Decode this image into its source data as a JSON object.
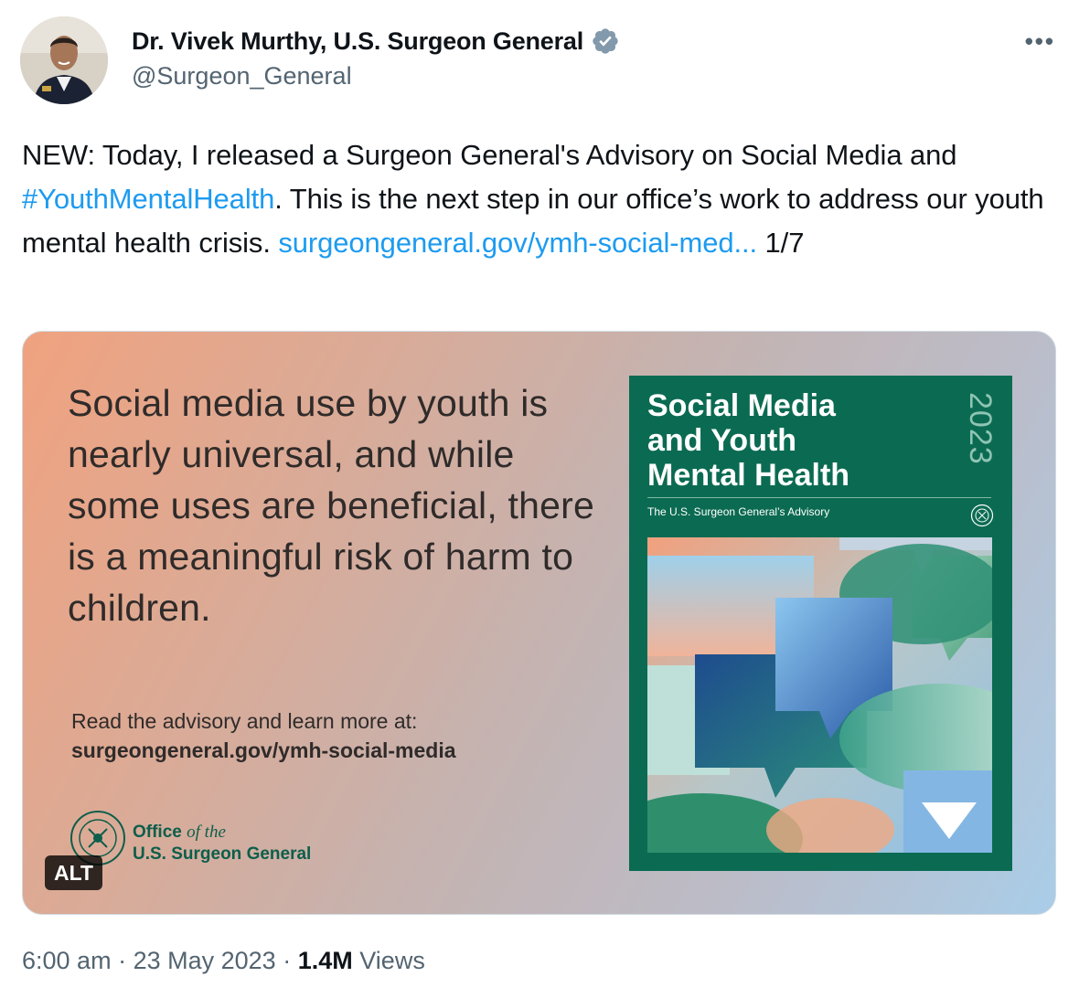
{
  "author": {
    "name": "Dr. Vivek Murthy, U.S. Surgeon General",
    "handle": "@Surgeon_General",
    "verified_icon": "verified-badge-icon"
  },
  "tweet": {
    "text_1": "NEW: Today, I released a Surgeon General's Advisory on Social Media and ",
    "hashtag": "#YouthMentalHealth",
    "text_2": ". This is the next step in our office’s work to address our youth mental health crisis. ",
    "link": "surgeongeneral.gov/ymh-social-med...",
    "text_3": " 1/7"
  },
  "card": {
    "quote": "Social media use by youth is nearly universal, and while some uses are beneficial, there is a meaningful risk of harm to children.",
    "read_label": "Read the advisory and learn more at:",
    "read_url": "surgeongeneral.gov/ymh-social-media",
    "office_line1": "Office",
    "office_of_the": "of the",
    "office_line2": "U.S. Surgeon General",
    "alt_badge": "ALT",
    "cover": {
      "title_1": "Social Media",
      "title_2": "and Youth",
      "title_3": "Mental Health",
      "year": "2023",
      "subtitle": "The U.S. Surgeon General’s Advisory"
    }
  },
  "meta": {
    "time": "6:00 am",
    "date": "23 May 2023",
    "views_count": "1.4M",
    "views_label": "Views",
    "separator": "·"
  },
  "colors": {
    "link": "#1d9bf0",
    "verified": "#829aab",
    "cover_green": "#0b6b52",
    "office_green": "#0d5e4b"
  }
}
